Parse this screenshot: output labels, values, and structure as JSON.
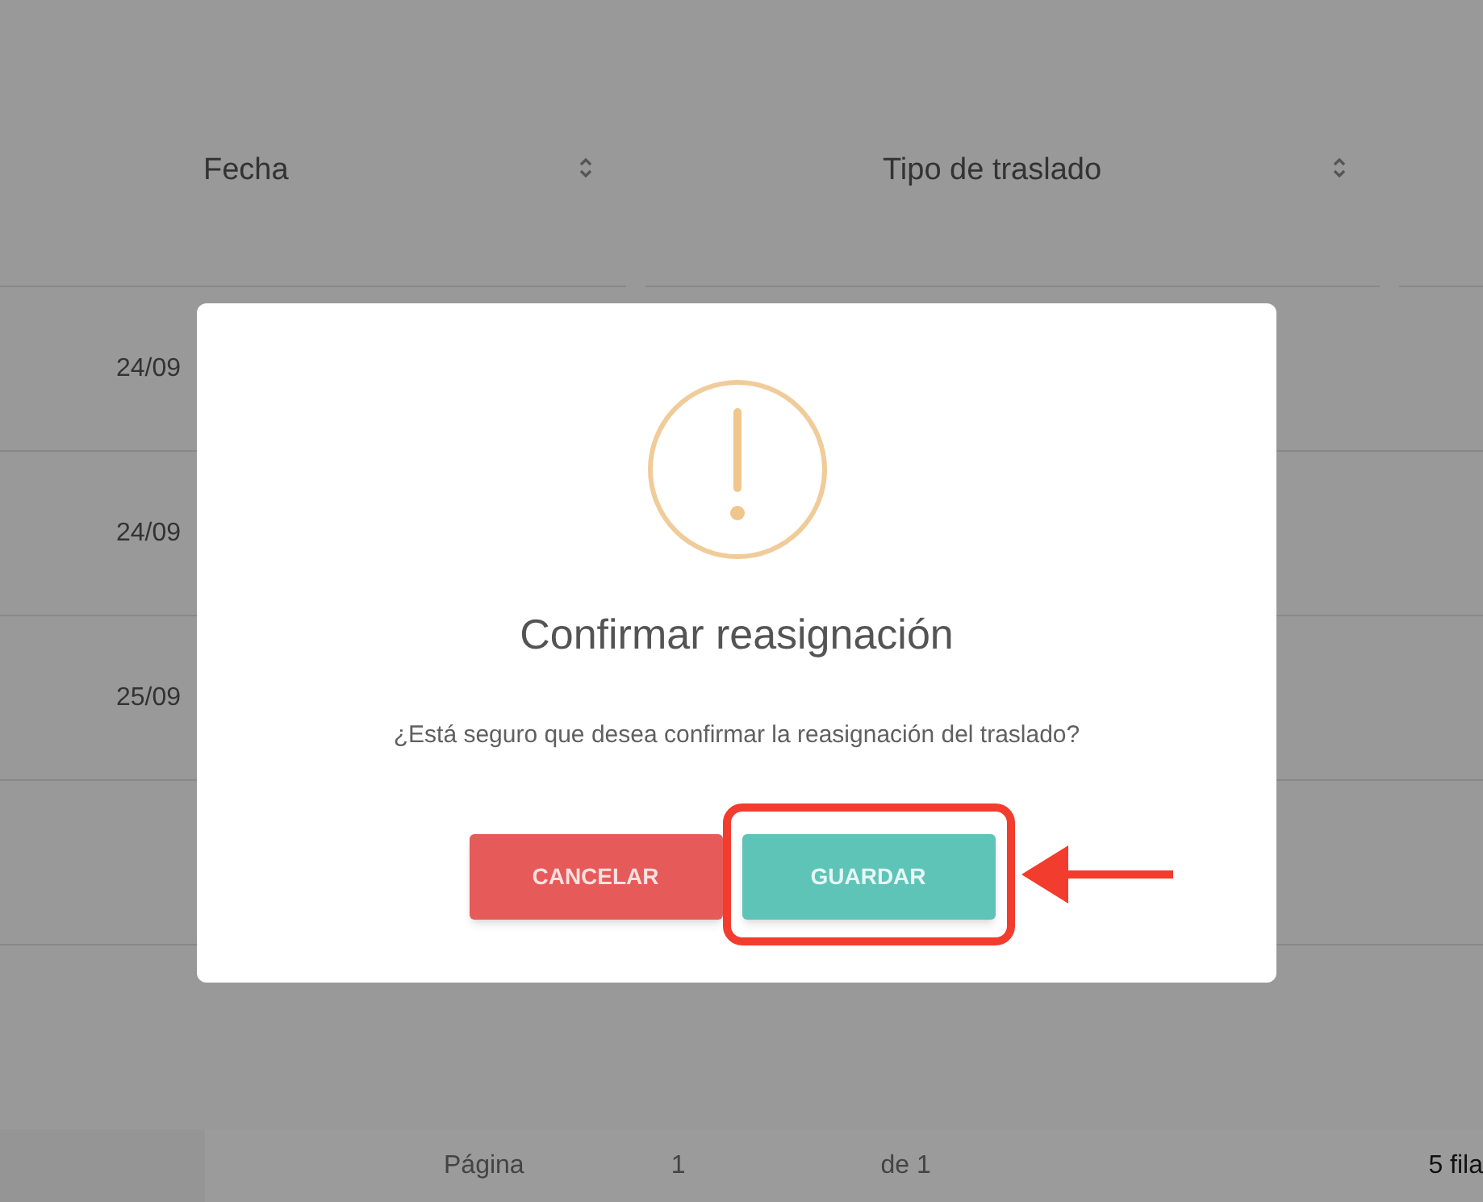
{
  "table": {
    "columns": [
      {
        "label": "Fecha",
        "sortable": true
      },
      {
        "label": "Tipo de traslado",
        "sortable": true
      }
    ],
    "rows": [
      {
        "fecha": "24/09"
      },
      {
        "fecha": "24/09"
      },
      {
        "fecha": "25/09"
      }
    ]
  },
  "pagination": {
    "page_label": "Página",
    "page": "1",
    "of": "de 1",
    "rows_per_page": "5 fila"
  },
  "dialog": {
    "title": "Confirmar reasignación",
    "message": "¿Está seguro que desea confirmar la reasignación del traslado?",
    "buttons": [
      {
        "label": "CANCELAR",
        "kind": "cancel",
        "highlighted": false
      },
      {
        "label": "GUARDAR",
        "kind": "confirm",
        "highlighted": true
      }
    ]
  }
}
